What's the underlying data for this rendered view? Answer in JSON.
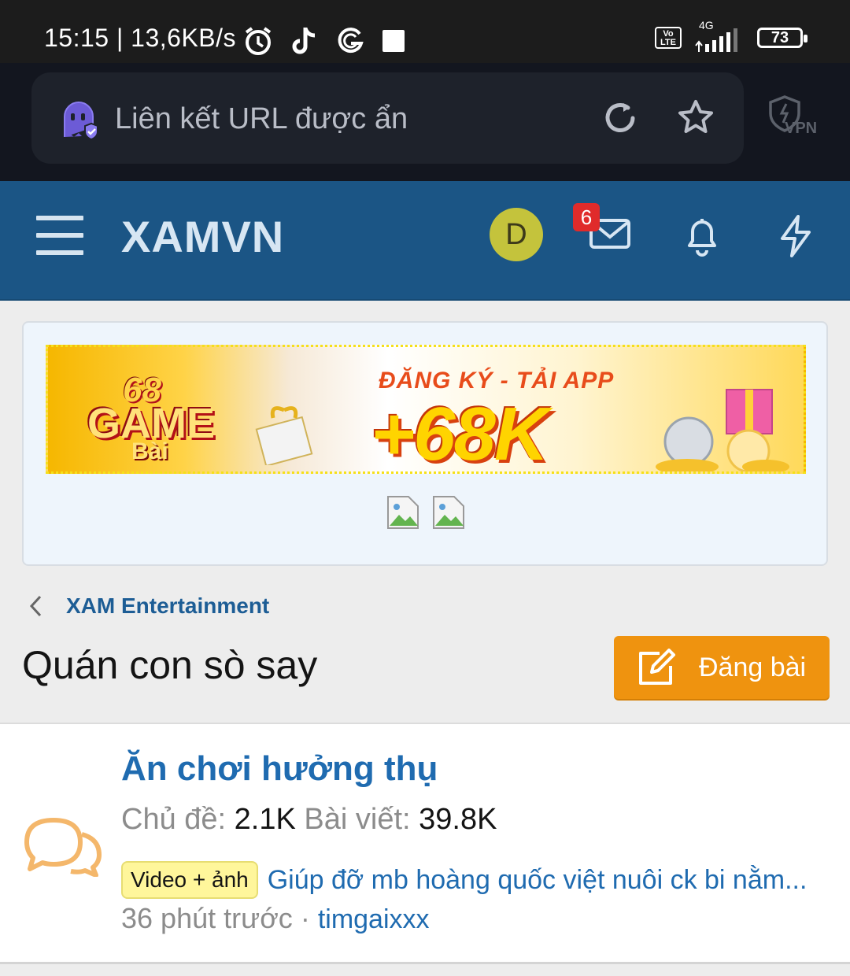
{
  "status_bar": {
    "time_speed": "15:15 | 13,6KB/s",
    "network": "4G",
    "volte": "Vo LTE",
    "battery": "73"
  },
  "browser": {
    "url_text": "Liên kết URL được ẩn",
    "vpn_label": "VPN"
  },
  "site_header": {
    "logo": "XAMVN",
    "avatar_initial": "D",
    "mail_badge": "6"
  },
  "ad": {
    "logo_number": "68",
    "logo_word": "GAME",
    "logo_sub": "Bài",
    "headline": "ĐĂNG KÝ - TẢI APP",
    "amount": "+68K"
  },
  "breadcrumb": {
    "label": "XAM Entertainment"
  },
  "page": {
    "title": "Quán con sò say",
    "post_button": "Đăng bài"
  },
  "forum": {
    "title": "Ăn chơi hưởng thụ",
    "threads_label": "Chủ đề:",
    "threads_value": "2.1K",
    "posts_label": "Bài viết:",
    "posts_value": "39.8K",
    "latest_prefix": "Video + ảnh",
    "latest_title": "Giúp đỡ mb hoàng quốc việt nuôi ck bi nằm...",
    "latest_time": "36 phút trước",
    "latest_sep": " · ",
    "latest_user": "timgaixxx"
  },
  "colors": {
    "header_bg": "#1b5585",
    "accent_button": "#ef930f",
    "link": "#1f6bb0",
    "badge": "#e02b2b"
  }
}
